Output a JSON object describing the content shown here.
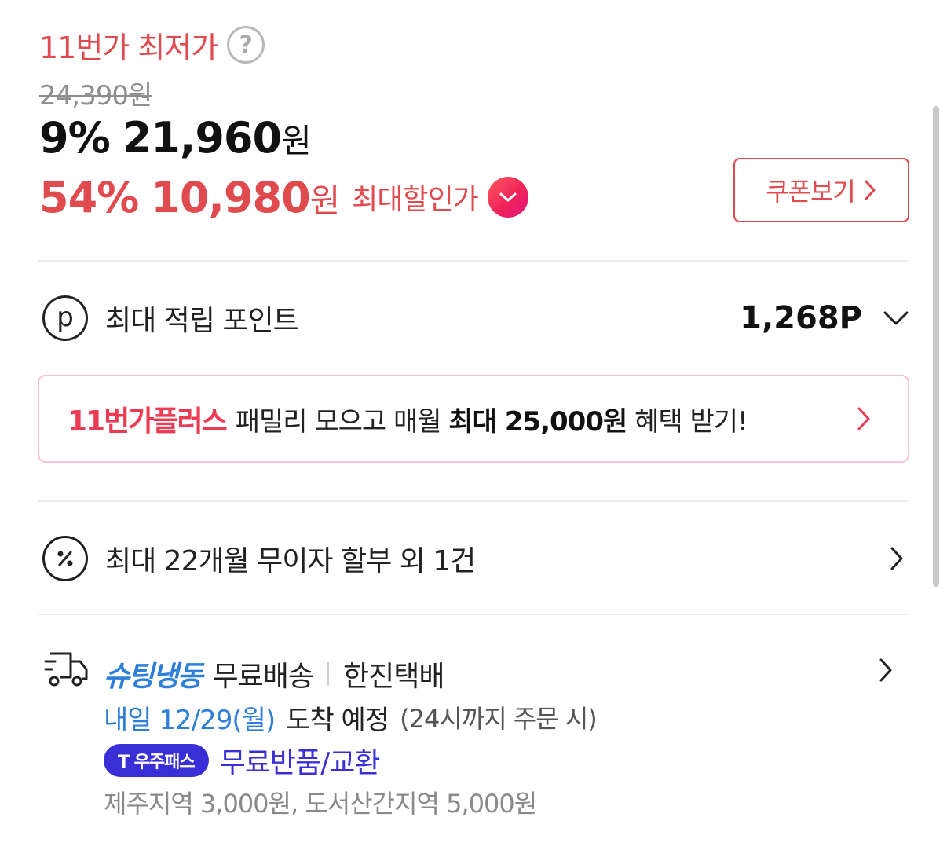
{
  "price": {
    "lowest_label": "11번가 최저가",
    "help_icon": "question-icon",
    "original_price": "24,390원",
    "sale_percent": "9%",
    "sale_amount": "21,960",
    "sale_unit": "원",
    "max_percent": "54%",
    "max_amount": "10,980",
    "max_unit": "원",
    "max_label": "최대할인가",
    "coupon_button": "쿠폰보기",
    "accent_color": "#e04b4f"
  },
  "points": {
    "icon": "point-icon",
    "icon_letter": "p",
    "label": "최대 적립 포인트",
    "value": "1,268P"
  },
  "plus_banner": {
    "brand": "11번가플러스",
    "text_before": "패밀리 모으고 매월",
    "text_bold": "최대 25,000원",
    "text_after": "혜택 받기!"
  },
  "installment": {
    "icon": "percent-icon",
    "label": "최대 22개월 무이자 할부 외 1건"
  },
  "shipping": {
    "icon": "truck-icon",
    "brand": "슈팅냉동",
    "free_label": "무료배송",
    "carrier": "한진택배",
    "eta_date": "내일 12/29(월)",
    "eta_label": "도착 예정",
    "eta_note": "(24시까지 주문 시)",
    "pass_badge": "T 우주패스",
    "return_label": "무료반품/교환",
    "extra_fee": "제주지역 3,000원, 도서산간지역 5,000원",
    "brand_color": "#2e7fd9",
    "pass_color": "#3a2fd6"
  }
}
